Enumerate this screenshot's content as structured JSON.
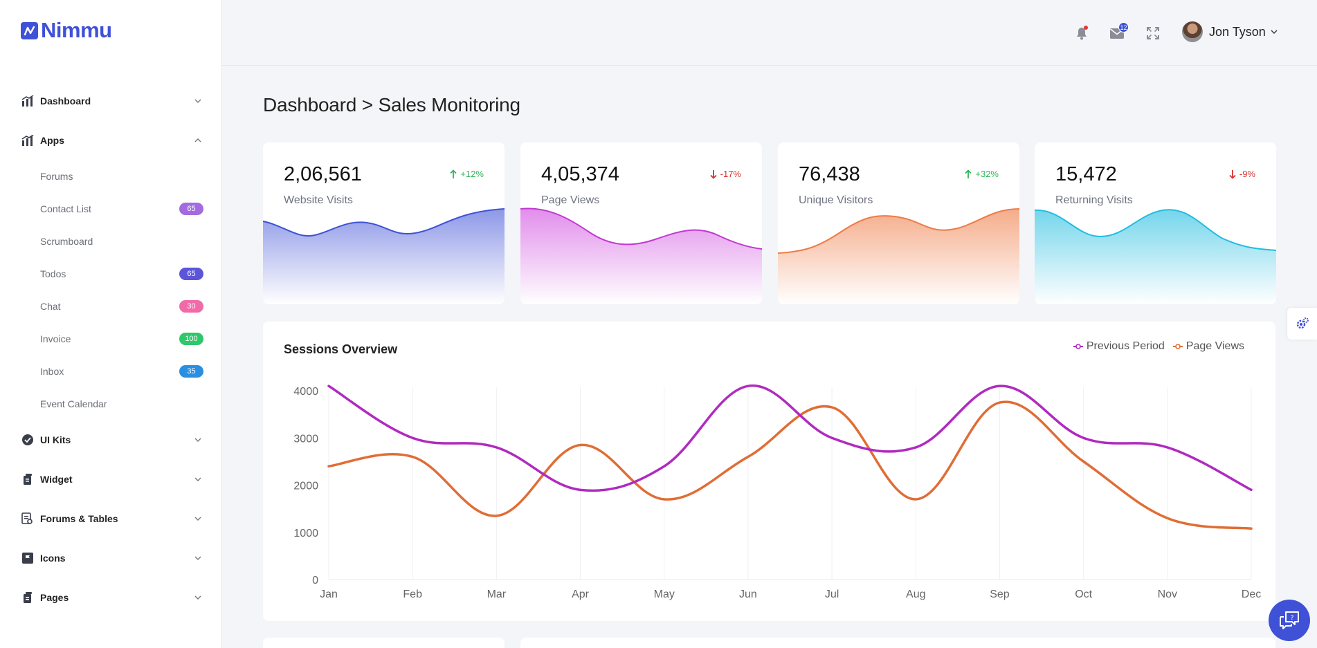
{
  "brand": {
    "name": "Nimmu",
    "accent": "#3f51d6"
  },
  "sidebar": {
    "groups_top": [
      {
        "label": "Dashboard",
        "icon": "chart-icon",
        "expanded": false
      },
      {
        "label": "Apps",
        "icon": "chart-icon",
        "expanded": true
      }
    ],
    "apps_items": [
      {
        "label": "Forums",
        "badge": "",
        "badge_color": ""
      },
      {
        "label": "Contact List",
        "badge": "65",
        "badge_color": "#a46be0"
      },
      {
        "label": "Scrumboard",
        "badge": "",
        "badge_color": ""
      },
      {
        "label": "Todos",
        "badge": "65",
        "badge_color": "#5c55d9"
      },
      {
        "label": "Chat",
        "badge": "30",
        "badge_color": "#f06ba8"
      },
      {
        "label": "Invoice",
        "badge": "100",
        "badge_color": "#2ec76a"
      },
      {
        "label": "Inbox",
        "badge": "35",
        "badge_color": "#2a8fe0"
      },
      {
        "label": "Event Calendar",
        "badge": "",
        "badge_color": ""
      }
    ],
    "groups_bottom": [
      {
        "label": "UI Kits",
        "icon": "check-circle-icon"
      },
      {
        "label": "Widget",
        "icon": "widget-icon"
      },
      {
        "label": "Forums & Tables",
        "icon": "table-icon"
      },
      {
        "label": "Icons",
        "icon": "flag-icon"
      },
      {
        "label": "Pages",
        "icon": "pages-icon"
      }
    ]
  },
  "header": {
    "message_count": "12",
    "user_name": "Jon Tyson"
  },
  "page": {
    "title": "Dashboard > Sales Monitoring"
  },
  "stats": [
    {
      "value": "2,06,561",
      "label": "Website Visits",
      "change": "+12%",
      "direction": "up",
      "color": "#3f51d6"
    },
    {
      "value": "4,05,374",
      "label": "Page Views",
      "change": "-17%",
      "direction": "down",
      "color": "#c03ad0"
    },
    {
      "value": "76,438",
      "label": "Unique Visitors",
      "change": "+32%",
      "direction": "up",
      "color": "#ef7b45"
    },
    {
      "value": "15,472",
      "label": "Returning Visits",
      "change": "-9%",
      "direction": "down",
      "color": "#22bde0"
    }
  ],
  "sessions": {
    "title": "Sessions Overview",
    "legend": [
      "Previous Period",
      "Page Views"
    ]
  },
  "chart_data": {
    "type": "line",
    "title": "Sessions Overview",
    "categories": [
      "Jan",
      "Feb",
      "Mar",
      "Apr",
      "May",
      "Jun",
      "Jul",
      "Aug",
      "Sep",
      "Oct",
      "Nov",
      "Dec"
    ],
    "series": [
      {
        "name": "Previous Period",
        "color": "#b02ac0",
        "values": [
          4100,
          3000,
          2800,
          1900,
          2400,
          4100,
          3000,
          2800,
          4100,
          3000,
          2800,
          1900
        ]
      },
      {
        "name": "Page Views",
        "color": "#e06d35",
        "values": [
          2400,
          2600,
          1350,
          2850,
          1700,
          2600,
          3650,
          1700,
          3750,
          2500,
          1300,
          1080
        ]
      }
    ],
    "y_ticks": [
      "4000",
      "3000",
      "2000",
      "1000",
      "0"
    ],
    "ylim": [
      0,
      4000
    ],
    "grid": "vertical",
    "legend_position": "top-right"
  }
}
